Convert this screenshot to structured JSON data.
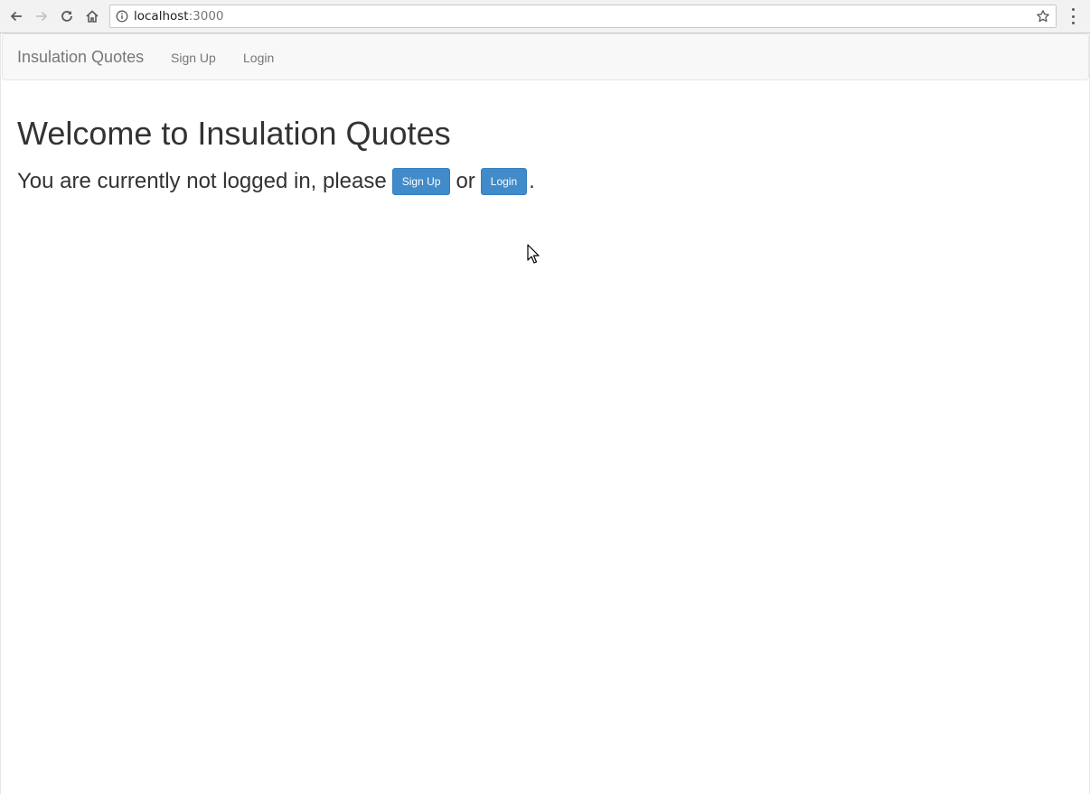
{
  "browser": {
    "url_host": "localhost",
    "url_port": ":3000"
  },
  "navbar": {
    "brand": "Insulation Quotes",
    "links": [
      "Sign Up",
      "Login"
    ]
  },
  "main": {
    "title": "Welcome to Insulation Quotes",
    "status_prefix": "You are currently not logged in, please",
    "signup_button": "Sign Up",
    "connector": "or",
    "login_button": "Login",
    "suffix": "."
  },
  "colors": {
    "primary_button": "#428bca",
    "navbar_bg": "#f8f8f8",
    "text": "#333333"
  },
  "icons": [
    "back-arrow-icon",
    "forward-arrow-icon",
    "reload-icon",
    "home-icon",
    "info-icon",
    "star-icon",
    "menu-dots-icon",
    "mouse-cursor-icon"
  ]
}
